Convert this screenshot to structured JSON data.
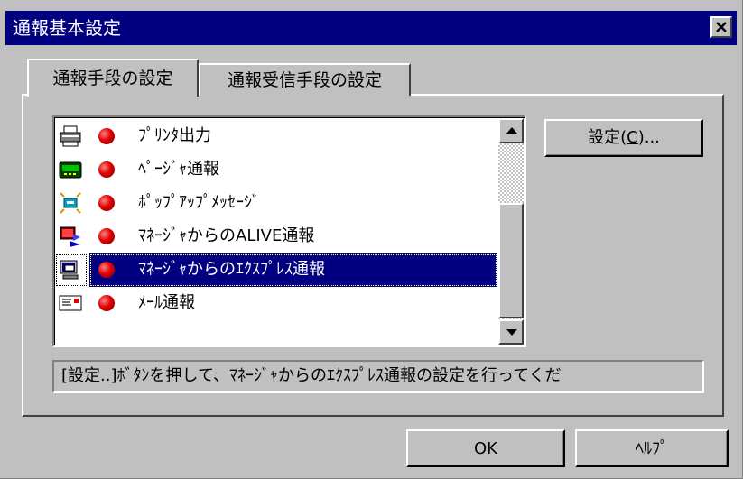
{
  "window": {
    "title": "通報基本設定"
  },
  "tabs": [
    {
      "label": "通報手段の設定",
      "active": true
    },
    {
      "label": "通報受信手段の設定",
      "active": false
    }
  ],
  "notification_list": {
    "items": [
      {
        "label": "ﾌﾟﾘﾝﾀ出力",
        "icon": "printer-icon",
        "status_color": "#e00000"
      },
      {
        "label": "ﾍﾟｰｼﾞｬ通報",
        "icon": "pager-icon",
        "status_color": "#e00000"
      },
      {
        "label": "ﾎﾟｯﾌﾟｱｯﾌﾟﾒｯｾｰｼﾞ",
        "icon": "popup-message-icon",
        "status_color": "#e00000"
      },
      {
        "label": "ﾏﾈｰｼﾞｬからのALIVE通報",
        "icon": "alive-notification-icon",
        "status_color": "#e00000"
      },
      {
        "label": "ﾏﾈｰｼﾞｬからのｴｸｽﾌﾟﾚｽ通報",
        "icon": "express-notification-icon",
        "status_color": "#e00000",
        "selected": true
      },
      {
        "label": "ﾒｰﾙ通報",
        "icon": "mail-icon",
        "status_color": "#e00000"
      }
    ]
  },
  "buttons": {
    "settings_label": "設定(",
    "settings_accel": "C",
    "settings_suffix": ")...",
    "ok_label": "OK",
    "help_label": "ﾍﾙﾌﾟ"
  },
  "status_text": "[設定..]ﾎﾞﾀﾝを押して、ﾏﾈｰｼﾞｬからのｴｸｽﾌﾟﾚｽ通報の設定を行ってくだ",
  "colors": {
    "titlebar": "#000080",
    "selection": "#000080",
    "status_dot": "#e00000"
  }
}
